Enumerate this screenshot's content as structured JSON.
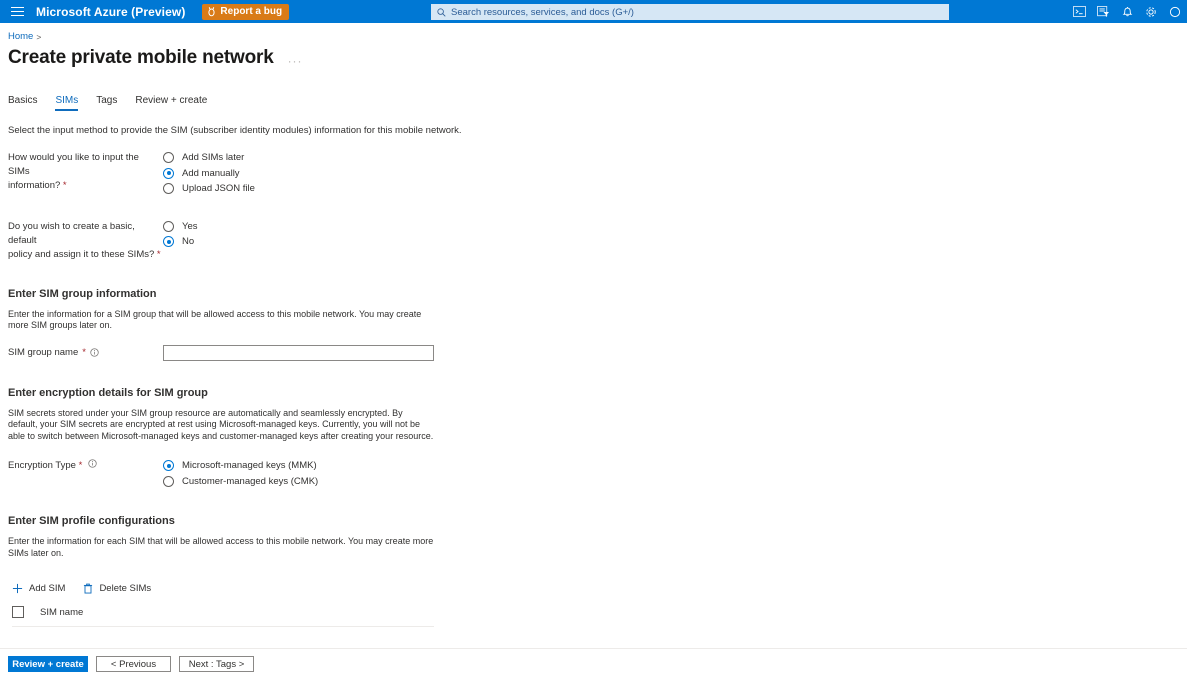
{
  "topbar": {
    "menu_icon": "hamburger-icon",
    "brand": "Microsoft Azure (Preview)",
    "report_bug": {
      "label": "Report a bug",
      "icon": "bug-icon",
      "color": "#d97b18"
    },
    "search": {
      "icon": "search-icon",
      "value": "",
      "placeholder": "Search resources, services, and docs (G+/)"
    },
    "icons": [
      {
        "name": "cloud-shell-icon"
      },
      {
        "name": "directory-filter-icon"
      },
      {
        "name": "notifications-bell-icon"
      },
      {
        "name": "settings-gear-icon"
      },
      {
        "name": "help-icon"
      }
    ],
    "accent": "#0078d4"
  },
  "breadcrumb": {
    "home": "Home",
    "separator": ">"
  },
  "page": {
    "title": "Create private mobile network",
    "more_menu": "···"
  },
  "tabs": [
    {
      "label": "Basics",
      "active": false
    },
    {
      "label": "SIMs",
      "active": true
    },
    {
      "label": "Tags",
      "active": false
    },
    {
      "label": "Review + create",
      "active": false
    }
  ],
  "intro": "Select the input method to provide the SIM (subscriber identity modules) information for this mobile network.",
  "input_method": {
    "label_line1": "How would you like to input the SIMs",
    "label_line2": "information?",
    "required_mark": "*",
    "options": [
      {
        "label": "Add SIMs later",
        "checked": false
      },
      {
        "label": "Add manually",
        "checked": true
      },
      {
        "label": "Upload JSON file",
        "checked": false
      }
    ]
  },
  "default_policy": {
    "label_line1": "Do you wish to create a basic, default",
    "label_line2": "policy and assign it to these SIMs?",
    "required_mark": "*",
    "options": [
      {
        "label": "Yes",
        "checked": false
      },
      {
        "label": "No",
        "checked": true
      }
    ]
  },
  "sim_group": {
    "heading": "Enter SIM group information",
    "description": "Enter the information for a SIM group that will be allowed access to this mobile network. You may create more SIM groups later on.",
    "name_field": {
      "label": "SIM group name",
      "required_mark": "*",
      "info_icon": "info-icon",
      "value": "",
      "placeholder": ""
    }
  },
  "encryption": {
    "heading": "Enter encryption details for SIM group",
    "description": "SIM secrets stored under your SIM group resource are automatically and seamlessly encrypted. By default, your SIM secrets are encrypted at rest using Microsoft-managed keys. Currently, you will not be able to switch between Microsoft-managed keys and customer-managed keys after creating your resource.",
    "label": "Encryption Type",
    "required_mark": "*",
    "info_icon": "info-icon",
    "options": [
      {
        "label": "Microsoft-managed keys (MMK)",
        "checked": true
      },
      {
        "label": "Customer-managed keys (CMK)",
        "checked": false
      }
    ]
  },
  "sim_profiles": {
    "heading": "Enter SIM profile configurations",
    "description": "Enter the information for each SIM that will be allowed access to this mobile network. You may create more SIMs later on.",
    "commands": [
      {
        "label": "Add SIM",
        "icon": "plus-icon"
      },
      {
        "label": "Delete SIMs",
        "icon": "trash-icon"
      }
    ],
    "table": {
      "select_all_checkbox": "select-all-checkbox",
      "columns": [
        "SIM name"
      ],
      "rows": []
    }
  },
  "footer": {
    "buttons": [
      {
        "label": "Review + create",
        "style": "primary"
      },
      {
        "label": "< Previous",
        "style": "default"
      },
      {
        "label": "Next : Tags >",
        "style": "default"
      }
    ]
  }
}
